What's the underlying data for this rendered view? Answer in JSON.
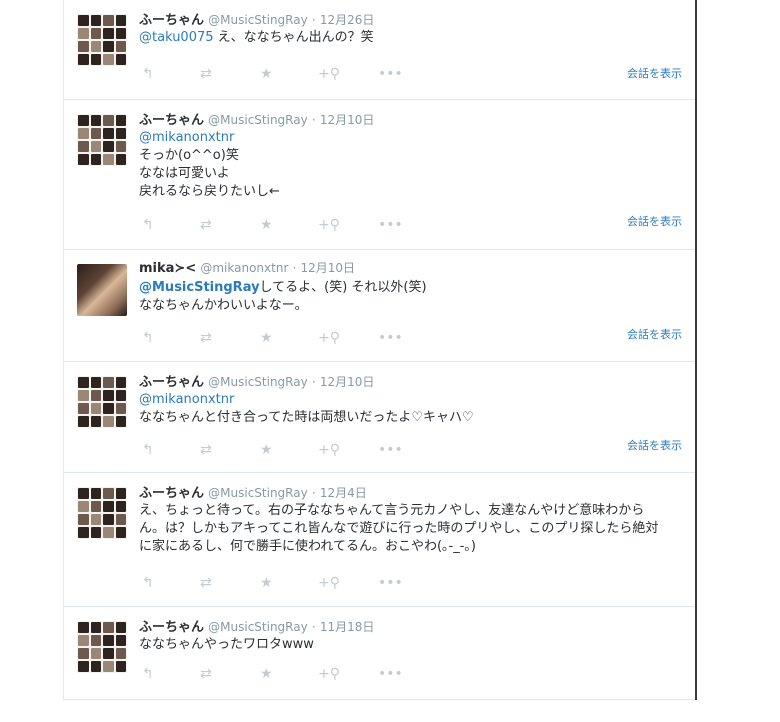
{
  "tweets": [
    {
      "name": "ふーちゃん",
      "handle": "@MusicStingRay",
      "date": "12月26日",
      "mention": "@taku0075",
      "lines": [
        "え、ななちゃん出んの？笑"
      ],
      "convo": "会話を表示"
    },
    {
      "name": "ふーちゃん",
      "handle": "@MusicStingRay",
      "date": "12月10日",
      "mention": "@mikanonxtnr",
      "lines": [
        "そっか(o^^o)笑",
        "ななは可愛いよ",
        "戻れるなら戻りたいし←"
      ],
      "convo": "会話を表示"
    },
    {
      "name": "mika≻<",
      "handle": "@mikanonxtnr",
      "date": "12月10日",
      "mention": "@MusicStingRay",
      "lines": [
        "してるよ、(笑) それ以外(笑)",
        "ななちゃんかわいいよなー。"
      ],
      "convo": "会話を表示"
    },
    {
      "name": "ふーちゃん",
      "handle": "@MusicStingRay",
      "date": "12月10日",
      "mention": "@mikanonxtnr",
      "lines": [
        "ななちゃんと付き合ってた時は両想いだったよ♡キャハ♡"
      ],
      "convo": "会話を表示"
    },
    {
      "name": "ふーちゃん",
      "handle": "@MusicStingRay",
      "date": "12月4日",
      "lines": [
        "え、ちょっと待って。右の子ななちゃんて言う元カノやし、友達なんやけど意味わから",
        "ん。は？しかもアキってこれ皆んなで遊びに行った時のプリやし、このプリ探したら絶対",
        "に家にあるし、何で勝手に使われてるん。おこやわ(｡-_-｡)"
      ]
    },
    {
      "name": "ふーちゃん",
      "handle": "@MusicStingRay",
      "date": "11月18日",
      "lines": [
        "ななちゃんやったワロタwww"
      ]
    }
  ],
  "icons": [
    "reply-icon",
    "retweet-icon",
    "favorite-icon",
    "follow-icon",
    "more-icon"
  ]
}
